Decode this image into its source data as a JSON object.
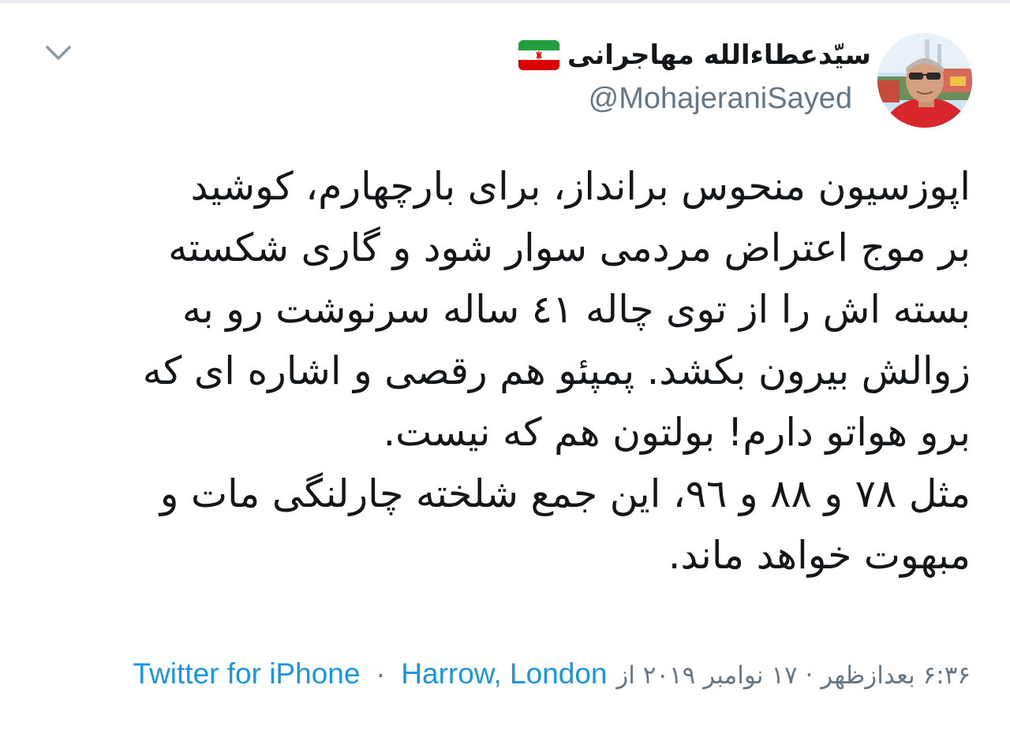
{
  "user": {
    "display_name": "سیّدعطاءالله مهاجرانی",
    "handle": "@MohajeraniSayed",
    "avatar_icon": "profile-photo-avatar",
    "flag_icon": "iran-flag-emoji"
  },
  "tweet": {
    "lines": [
      "اپوزسیون منحوس برانداز، برای بارچهارم، کوشید",
      "بر موج اعتراض مردمی سوار شود و گاری شکسته",
      "بسته اش را از توی چاله ٤١ ساله سرنوشت رو به",
      "زوالش بیرون بکشد. پمپئو هم رقصی و اشاره ای که",
      "برو هواتو دارم! بولتون هم که نیست.",
      "مثل ٧٨ و ٨٨ و ٩٦، این جمع شلخته چارلنگی مات و",
      "مبهوت خواهد ماند."
    ]
  },
  "meta": {
    "time_date": "۶:۳۶ بعدازظهر · ۱۷ نوامبر ۲۰۱۹ از",
    "source": "Twitter for iPhone",
    "separator": "·",
    "location": "Harrow, London"
  },
  "controls": {
    "menu_icon": "chevron-down-icon"
  },
  "colors": {
    "link": "#1b95e0",
    "secondary_text": "#657786",
    "primary_text": "#14171a"
  }
}
